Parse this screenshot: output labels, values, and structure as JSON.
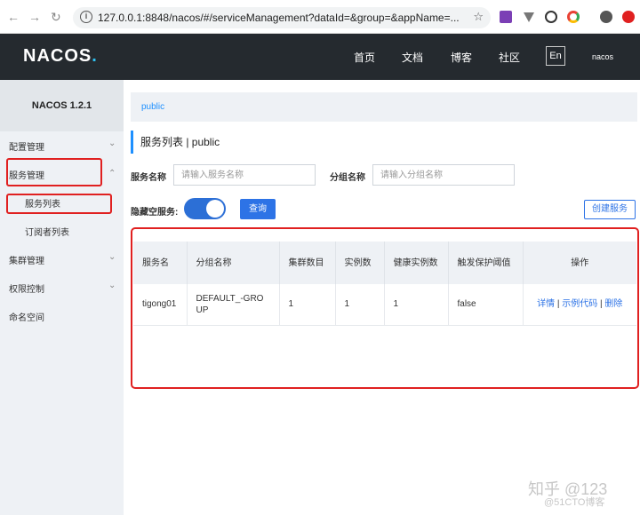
{
  "browser": {
    "url": "127.0.0.1:8848/nacos/#/serviceManagement?dataId=&group=&appName=...",
    "back_icon": "arrow-left",
    "forward_icon": "arrow-right",
    "reload_icon": "reload",
    "info_icon": "info",
    "star_icon": "star"
  },
  "topnav": {
    "logo_text": "NACOS",
    "logo_dot": ".",
    "items": [
      "首页",
      "文档",
      "博客",
      "社区"
    ],
    "lang": "En",
    "user": "nacos"
  },
  "sidebar": {
    "brand": "NACOS 1.2.1",
    "items": [
      {
        "label": "配置管理"
      },
      {
        "label": "服务管理"
      },
      {
        "label": "服务列表"
      },
      {
        "label": "订阅者列表"
      },
      {
        "label": "集群管理"
      },
      {
        "label": "权限控制"
      },
      {
        "label": "命名空间"
      }
    ]
  },
  "main": {
    "namespace_tab": "public",
    "page_title": "服务列表 | public",
    "service_name_label": "服务名称",
    "service_name_placeholder": "请输入服务名称",
    "group_name_label": "分组名称",
    "group_name_placeholder": "请输入分组名称",
    "hide_empty_label": "隐藏空服务:",
    "query_button": "查询",
    "create_button": "创建服务"
  },
  "table": {
    "headers": [
      "服务名",
      "分组名称",
      "集群数目",
      "实例数",
      "健康实例数",
      "触发保护阈值",
      "操作"
    ],
    "rows": [
      {
        "service": "tigong01",
        "group": "DEFAULT_-GROUP",
        "clusters": "1",
        "instances": "1",
        "healthy": "1",
        "threshold": "false",
        "op_detail": "详情",
        "op_sample": "示例代码",
        "op_delete": "删除",
        "op_sep": "|"
      }
    ]
  },
  "watermark": {
    "line1": "知乎 @123",
    "line2": "@51CTO博客"
  },
  "colors": {
    "navbar": "#252a2f",
    "accent": "#2d73e6",
    "highlight": "#e02020"
  }
}
